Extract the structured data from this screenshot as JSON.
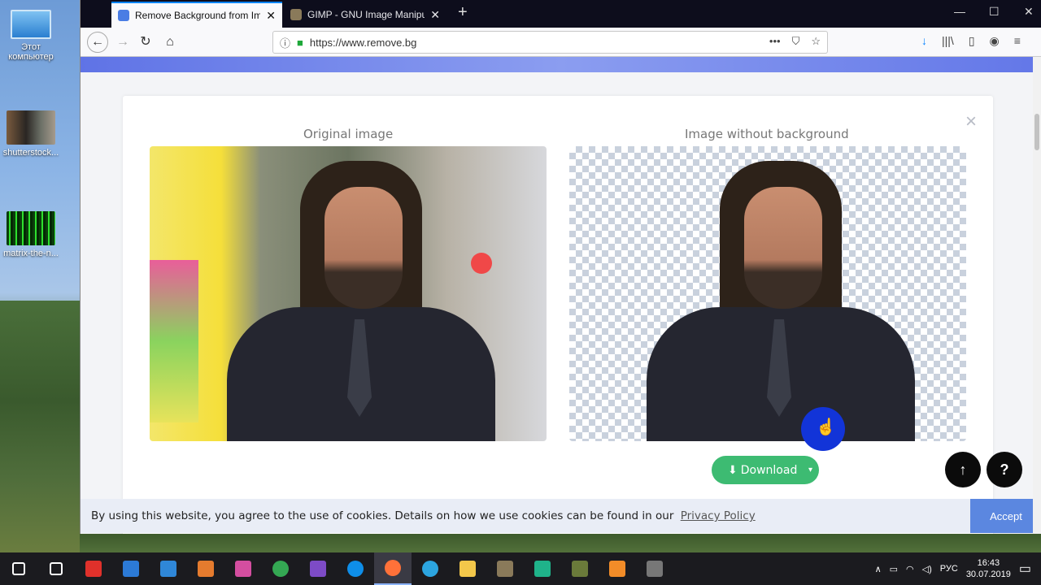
{
  "desktop": {
    "icons": [
      {
        "label": "Этот\nкомпьютер",
        "icon": "computer-icon"
      },
      {
        "label": "shutterstock...",
        "icon": "photo-thumbnail-icon"
      },
      {
        "label": "matrix-the-n...",
        "icon": "matrix-thumbnail-icon"
      }
    ]
  },
  "browser": {
    "tabs": [
      {
        "title": "Remove Background from Ima",
        "active": true,
        "favicon_color": "#4a7de4"
      },
      {
        "title": "GIMP - GNU Image Manipulati",
        "active": false,
        "favicon_color": "#8a7a5a"
      }
    ],
    "new_tab_symbol": "+",
    "window_controls": {
      "minimize": "—",
      "maximize": "☐",
      "close": "✕"
    },
    "url": "https://www.remove.bg",
    "nav": {
      "back": "←",
      "forward": "→",
      "reload": "↻",
      "home": "⌂"
    },
    "url_actions": {
      "more": "•••",
      "pocket": "⛉",
      "bookmark": "☆"
    },
    "toolbar": {
      "download": "↓",
      "library": "|||\\",
      "sidebar": "▯",
      "account": "◉",
      "menu": "≡"
    }
  },
  "page": {
    "banner_color": "#6b7fe8",
    "modal": {
      "close_symbol": "×",
      "original_title": "Original image",
      "nobg_title": "Image without background",
      "download_label": "Download",
      "download_icon": "⬇",
      "download_caret": "▾",
      "download_color": "#3dbb72"
    },
    "scroll_top_symbol": "↑",
    "help_symbol": "?",
    "cookie": {
      "text": "By using this website, you agree to the use of cookies. Details on how we use cookies can be found in our",
      "link": "Privacy Policy",
      "accept": "Accept"
    }
  },
  "taskbar": {
    "apps": [
      {
        "name": "start-icon",
        "color": "#ffffff"
      },
      {
        "name": "task-view-icon",
        "color": "#ffffff"
      },
      {
        "name": "app-red-icon",
        "color": "#e0312b"
      },
      {
        "name": "app-blue-window-icon",
        "color": "#2c7ad6"
      },
      {
        "name": "app-blue-square-icon",
        "color": "#2f87d8"
      },
      {
        "name": "app-colorful-icon",
        "color": "#e57b2e"
      },
      {
        "name": "app-paint-icon",
        "color": "#d44ea0"
      },
      {
        "name": "chrome-icon",
        "color": "#34a853"
      },
      {
        "name": "app-purple-icon",
        "color": "#7d4bc6"
      },
      {
        "name": "teamviewer-icon",
        "color": "#0e8ee9"
      },
      {
        "name": "firefox-icon",
        "color": "#ff7139"
      },
      {
        "name": "telegram-icon",
        "color": "#2ca5e0"
      },
      {
        "name": "file-explorer-icon",
        "color": "#f3c74a"
      },
      {
        "name": "gimp-icon",
        "color": "#8a7a5a"
      },
      {
        "name": "app-green-icon",
        "color": "#1fb38a"
      },
      {
        "name": "app-game-icon",
        "color": "#6a7a3a"
      },
      {
        "name": "app-orange-icon",
        "color": "#f28c28"
      },
      {
        "name": "app-active-icon",
        "color": "#777777"
      }
    ],
    "tray": {
      "chevron": "∧",
      "lang": "РУС",
      "time": "16:43",
      "date": "30.07.2019",
      "notification": "▭"
    }
  }
}
